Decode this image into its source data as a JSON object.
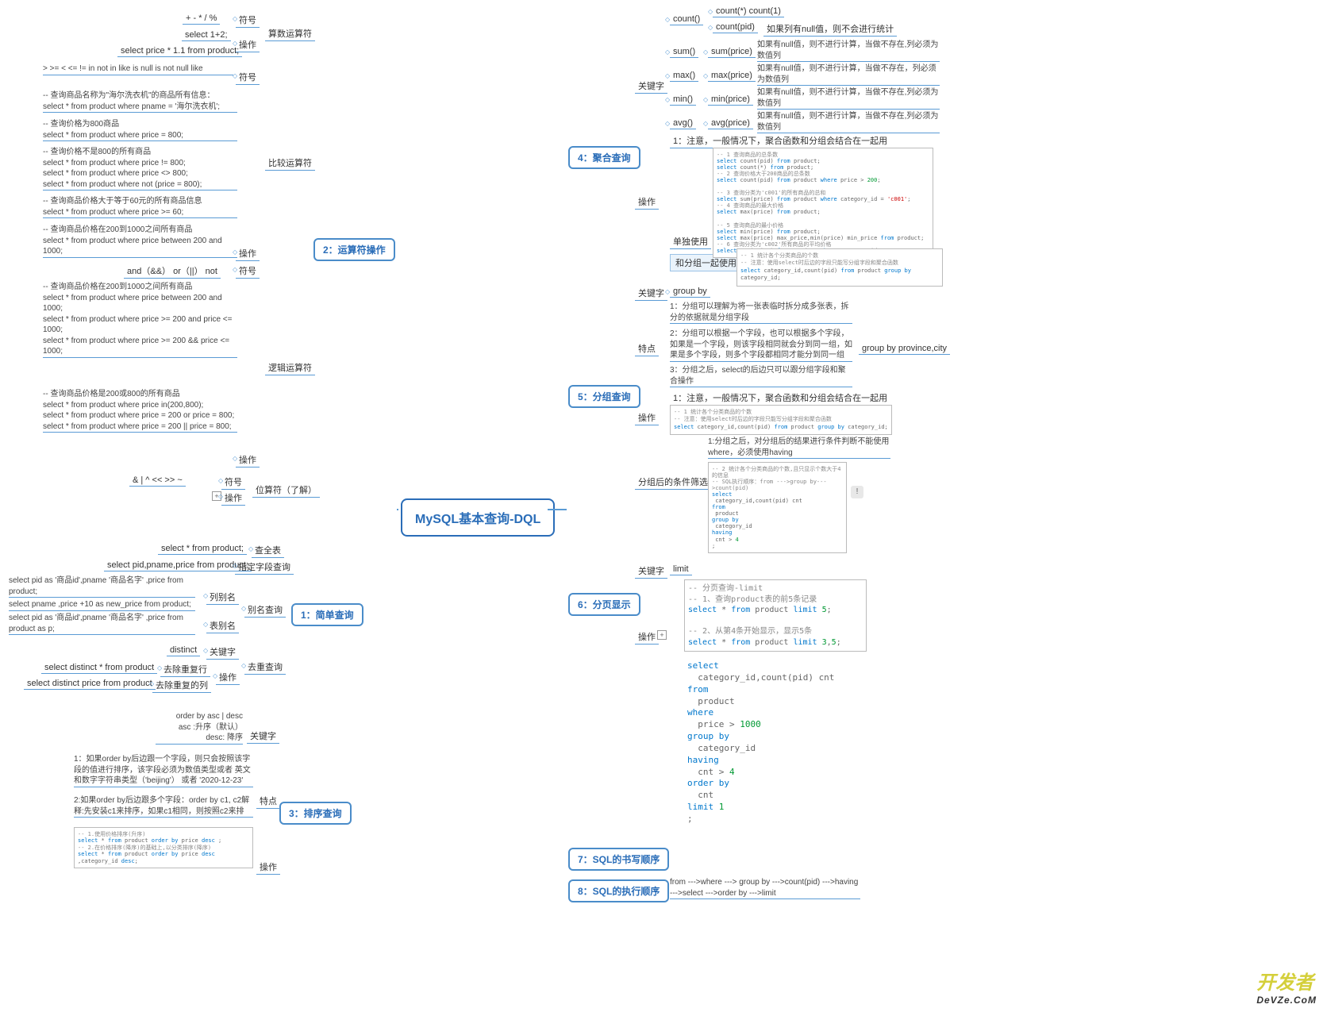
{
  "root": "MySQL基本查询-DQL",
  "left": {
    "t1": {
      "title": "1：简单查询",
      "s1": {
        "l": "查全表",
        "c": "select * from product;"
      },
      "s2": {
        "l": "指定字段查询",
        "c": "select pid,pname,price from product;"
      },
      "s3": {
        "l": "别名查询",
        "a": "列别名",
        "b": "表别名",
        "c1": "select pid as '商品id',pname '商品名字' ,price from product;",
        "c2": "select pname ,price +10 as new_price from product;",
        "c3": "select pid as '商品id',pname '商品名字' ,price from product as p;"
      },
      "s4": {
        "l": "去重查询",
        "a": "关键字",
        "av": "distinct",
        "b": "操作",
        "b1": "去除重复行",
        "b1c": "select distinct * from product",
        "b2": "去除重复的列",
        "b2c": "select distinct price from product"
      }
    },
    "t2": {
      "title": "2：运算符操作",
      "s1": {
        "l": "算数运算符",
        "a": "符号",
        "av": "+  -  *  /  %",
        "b": "操作",
        "b1": "select  1+2;",
        "b2": "select price * 1.1 from product;"
      },
      "s2": {
        "l": "比较运算符",
        "a": "符号",
        "av": ">  >=   <  <=  !=      in    not in    like      is null   is not null    like",
        "b": "操作",
        "c1": "-- 查询商品名称为\"海尔洗衣机\"的商品所有信息：\nselect * from product where pname = '海尔洗衣机';",
        "c2": "-- 查询价格为800商品\nselect * from product where price = 800;",
        "c3": "-- 查询价格不是800的所有商品\nselect * from product where price != 800;\nselect * from product where price <> 800;\nselect * from product where not (price = 800);",
        "c4": "-- 查询商品价格大于等于60元的所有商品信息\nselect * from product where price >= 60;",
        "c5": "-- 查询商品价格在200到1000之间所有商品\nselect * from product where price between 200 and 1000;"
      },
      "s3": {
        "l": "逻辑运算符",
        "a": "符号",
        "av": "and（&&）  or（||）  not",
        "b": "操作",
        "c1": "-- 查询商品价格在200到1000之间所有商品\nselect * from product where price between 200 and 1000;\nselect * from product where price >= 200 and price <= 1000;\nselect * from product where price >= 200 && price <= 1000;",
        "c2": "-- 查询商品价格是200或800的所有商品\nselect * from product where price in(200,800);\nselect * from product where price = 200 or price = 800;\nselect * from product where price = 200 || price = 800;"
      },
      "s4": {
        "l": "位算符（了解）",
        "a": "符号",
        "av": "&   |   ^   <<    >>    ~",
        "b": "操作"
      }
    },
    "t3": {
      "title": "3：排序查询",
      "s1": {
        "l": "关键字",
        "c": "order by  asc | desc\nasc :升序（默认）\ndesc: 降序"
      },
      "s2": {
        "l": "特点",
        "c1": "1：如果order by后边跟一个字段，则只会按照该字段的值进行排序，该字段必须为数值类型或者   英文和数字字符串类型（'beijing'）  或者 '2020-12-23'",
        "c2": "2:如果order by后边跟多个字段：order by c1, c2解释:先安装c1来排序，如果c1相同，则按照c2来排"
      },
      "s3": {
        "l": "操作"
      }
    }
  },
  "right": {
    "t4": {
      "title": "4：聚合查询",
      "kw": "关键字",
      "k1": {
        "n": "count()",
        "a": "count(*)  count(1)",
        "b": "count(pid)",
        "bd": "如果列有null值，则不会进行统计"
      },
      "k2": {
        "n": "sum()",
        "v": "sum(price)",
        "d": "如果有null值，则不进行计算，当做不存在,列必须为数值列"
      },
      "k3": {
        "n": "max()",
        "v": "max(price)",
        "d": "如果有null值，则不进行计算，当做不存在，列必须为数值列"
      },
      "k4": {
        "n": "min()",
        "v": "min(price)",
        "d": "如果有null值，则不进行计算，当做不存在,列必须为数值列"
      },
      "k5": {
        "n": "avg()",
        "v": "avg(price)",
        "d": "如果有null值，则不进行计算，当做不存在,列必须为数值列"
      },
      "op": "操作",
      "op1": "1：注意，一般情况下，聚合函数和分组会结合在一起用",
      "op2": "单独使用",
      "op3": "和分组一起使用"
    },
    "t5": {
      "title": "5：分组查询",
      "kw": "关键字",
      "kwv": "group by",
      "td": "特点",
      "td1": "1：分组可以理解为将一张表临时拆分成多张表，拆分的依据就是分组字段",
      "td2": "2：分组可以根据一个字段，也可以根据多个字段，如果是一个字段，则该字段相同就会分到同一组，如果是多个字段，则多个字段都相同才能分到同一组",
      "td2e": "group  by province,city",
      "td3": "3：分组之后，select的后边只可以跟分组字段和聚合操作",
      "op": "操作",
      "op1": "1：注意，一般情况下，聚合函数和分组会结合在一起用",
      "fl": "分组后的条件筛选",
      "fl1": "1:分组之后，对分组后的结果进行条件判断不能使用where，必须使用having"
    },
    "t6": {
      "title": "6：分页显示",
      "kw": "关键字",
      "kwv": "limit",
      "op": "操作",
      "c1": "-- 分页查询-limit\n-- 1、查询product表的前5条记录\nselect * from product limit 5;\n\n-- 2、从第4条开始显示，显示5条\nselect * from product limit 3,5;",
      "big": "select\n  category_id,count(pid) cnt\nfrom\n  product\nwhere\n  price > 1000\ngroup by\n  category_id\nhaving\n  cnt > 4\norder by\n  cnt\nlimit 1\n;"
    },
    "t7": {
      "title": "7：SQL的书写顺序"
    },
    "t8": {
      "title": "8：SQL的执行顺序",
      "d": "from --->where ---> group by --->count(pid) --->having --->select --->order by --->limit"
    }
  },
  "logo": {
    "a": "开发者",
    "b": "DeVZe.CoM"
  }
}
